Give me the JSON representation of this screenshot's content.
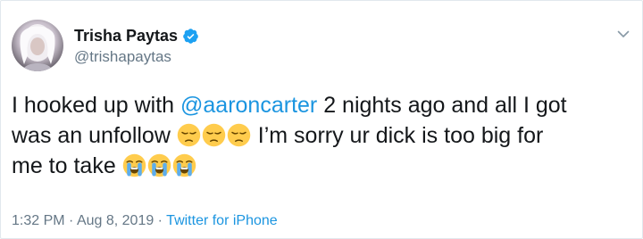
{
  "tweet": {
    "author": {
      "display_name": "Trisha Paytas",
      "handle": "@trishapaytas",
      "verified": true
    },
    "text": {
      "line1_prefix": "I hooked up with ",
      "mention": "@aaroncarter",
      "line1_suffix": " 2 nights ago and all I got",
      "line2_prefix": "was an unfollow ",
      "line2_suffix": " I’m sorry ur dick is too big for",
      "line3": "me to take "
    },
    "emojis": {
      "line2": [
        "pensive-face",
        "pensive-face",
        "pensive-face"
      ],
      "line3": [
        "loudly-crying-face",
        "loudly-crying-face",
        "loudly-crying-face"
      ]
    },
    "meta": {
      "time": "1:32 PM",
      "separator1": " · ",
      "date": "Aug 8, 2019",
      "separator2": " · ",
      "source": "Twitter for iPhone"
    }
  },
  "colors": {
    "link": "#1b95e0",
    "verified_badge": "#1da1f2",
    "secondary_text": "#657786",
    "primary_text": "#14171a",
    "emoji_face": "#ffcc4d"
  },
  "icons": {
    "verified": "verified-badge-icon",
    "menu": "chevron-down-icon"
  }
}
